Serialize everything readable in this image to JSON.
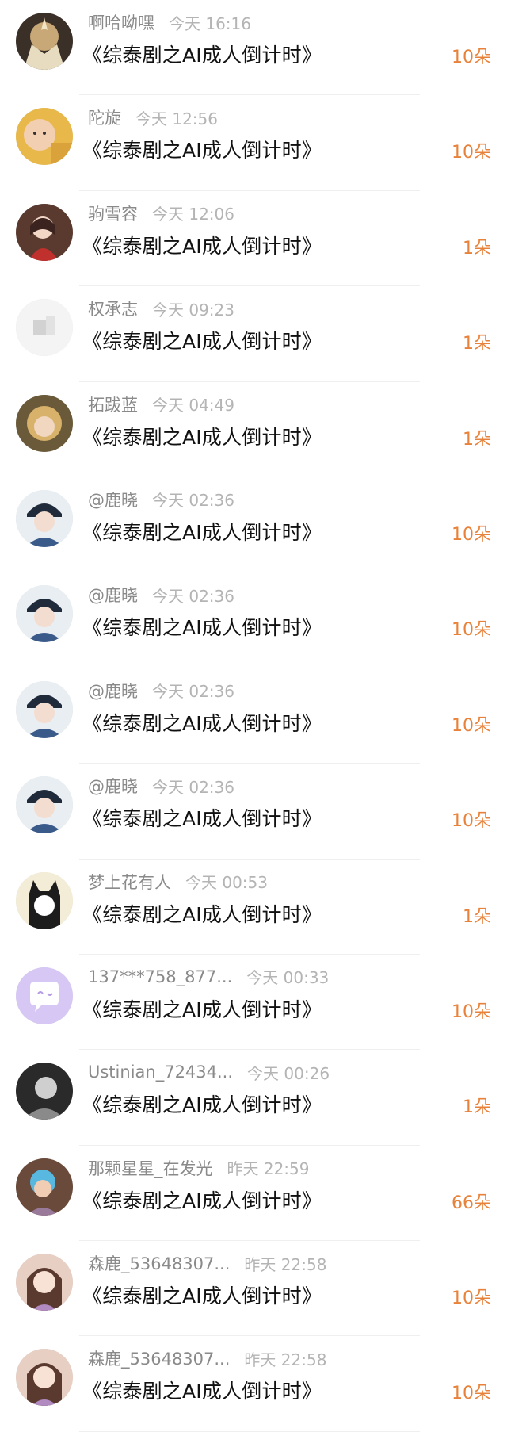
{
  "gifts": {
    "accent_color": "#e8823a",
    "items": [
      {
        "user": "啊哈呦嘿",
        "time": "今天 16:16",
        "title": "《综泰剧之AI成人倒计时》",
        "amount": "10朵",
        "avatar_icon": "avatar-fantasy-icon"
      },
      {
        "user": "陀旋",
        "time": "今天 12:56",
        "title": "《综泰剧之AI成人倒计时》",
        "amount": "10朵",
        "avatar_icon": "avatar-baby-icon"
      },
      {
        "user": "驹雪容",
        "time": "今天 12:06",
        "title": "《综泰剧之AI成人倒计时》",
        "amount": "1朵",
        "avatar_icon": "avatar-girl-red-icon"
      },
      {
        "user": "权承志",
        "time": "今天 09:23",
        "title": "《综泰剧之AI成人倒计时》",
        "amount": "1朵",
        "avatar_icon": "avatar-sketch-icon"
      },
      {
        "user": "拓跋蓝",
        "time": "今天 04:49",
        "title": "《综泰剧之AI成人倒计时》",
        "amount": "1朵",
        "avatar_icon": "avatar-girl-blonde-icon"
      },
      {
        "user": "@鹿晓",
        "time": "今天 02:36",
        "title": "《综泰剧之AI成人倒计时》",
        "amount": "10朵",
        "avatar_icon": "avatar-cap-boy-icon"
      },
      {
        "user": "@鹿晓",
        "time": "今天 02:36",
        "title": "《综泰剧之AI成人倒计时》",
        "amount": "10朵",
        "avatar_icon": "avatar-cap-boy-icon"
      },
      {
        "user": "@鹿晓",
        "time": "今天 02:36",
        "title": "《综泰剧之AI成人倒计时》",
        "amount": "10朵",
        "avatar_icon": "avatar-cap-boy-icon"
      },
      {
        "user": "@鹿晓",
        "time": "今天 02:36",
        "title": "《综泰剧之AI成人倒计时》",
        "amount": "10朵",
        "avatar_icon": "avatar-cap-boy-icon"
      },
      {
        "user": "梦上花有人",
        "time": "今天 00:53",
        "title": "《综泰剧之AI成人倒计时》",
        "amount": "1朵",
        "avatar_icon": "avatar-anime-cat-icon"
      },
      {
        "user": "137***758_877...",
        "time": "今天 00:33",
        "title": "《综泰剧之AI成人倒计时》",
        "amount": "10朵",
        "avatar_icon": "avatar-default-chat-icon"
      },
      {
        "user": "Ustinian_72434...",
        "time": "今天 00:26",
        "title": "《综泰剧之AI成人倒计时》",
        "amount": "1朵",
        "avatar_icon": "avatar-bw-girl-icon"
      },
      {
        "user": "那颗星星_在发光",
        "time": "昨天 22:59",
        "title": "《综泰剧之AI成人倒计时》",
        "amount": "66朵",
        "avatar_icon": "avatar-kid-icon"
      },
      {
        "user": "森鹿_53648307...",
        "time": "昨天 22:58",
        "title": "《综泰剧之AI成人倒计时》",
        "amount": "10朵",
        "avatar_icon": "avatar-girl-illustration-icon"
      },
      {
        "user": "森鹿_53648307...",
        "time": "昨天 22:58",
        "title": "《综泰剧之AI成人倒计时》",
        "amount": "10朵",
        "avatar_icon": "avatar-girl-illustration-icon"
      }
    ]
  }
}
